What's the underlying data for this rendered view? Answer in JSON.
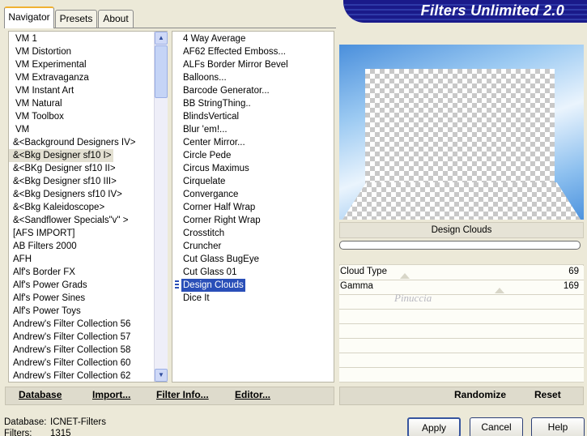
{
  "window": {
    "title": "Filters Unlimited 2.0"
  },
  "tabs": [
    {
      "label": "Navigator",
      "active": true
    },
    {
      "label": "Presets",
      "active": false
    },
    {
      "label": "About",
      "active": false
    }
  ],
  "categories": [
    "VM 1",
    "VM Distortion",
    "VM Experimental",
    "VM Extravaganza",
    "VM Instant Art",
    "VM Natural",
    "VM Toolbox",
    "VM",
    "&<Background Designers IV>",
    "&<Bkg Designer sf10 I>",
    "&<BKg Designer sf10 II>",
    "&<Bkg Designer sf10 III>",
    "&<Bkg Designers sf10 IV>",
    "&<Bkg Kaleidoscope>",
    "&<Sandflower Specials\"v\" >",
    "[AFS IMPORT]",
    "AB Filters 2000",
    "AFH",
    "Alf's Border FX",
    "Alf's Power Grads",
    "Alf's Power Sines",
    "Alf's Power Toys",
    "Andrew's Filter Collection 56",
    "Andrew's Filter Collection 57",
    "Andrew's Filter Collection 58",
    "Andrew's Filter Collection 60",
    "Andrew's Filter Collection 62"
  ],
  "selected_category": "&<Bkg Designer sf10 I>",
  "filters": [
    "4 Way Average",
    "AF62 Effected Emboss...",
    "ALFs Border Mirror Bevel",
    "Balloons...",
    "Barcode Generator...",
    "BB StringThing..",
    "BlindsVertical",
    "Blur 'em!...",
    "Center Mirror...",
    "Circle Pede",
    "Circus Maximus",
    "Cirquelate",
    "Convergance",
    "Corner Half Wrap",
    "Corner Right Wrap",
    "Crosstitch",
    "Cruncher",
    "Cut Glass  BugEye",
    "Cut Glass 01",
    "Design Clouds",
    "Dice It"
  ],
  "selected_filter": "Design Clouds",
  "preview": {
    "filter_name": "Design Clouds",
    "progress": 0
  },
  "params": [
    {
      "label": "Cloud Type",
      "value": "69",
      "level": 0.27
    },
    {
      "label": "Gamma",
      "value": "169",
      "level": 0.66
    }
  ],
  "bottom_buttons": {
    "database": "Database",
    "import": "Import...",
    "filter_info": "Filter Info...",
    "editor": "Editor...",
    "randomize": "Randomize",
    "reset": "Reset"
  },
  "footer": {
    "database_label": "Database:",
    "database_value": "ICNET-Filters",
    "filters_label": "Filters:",
    "filters_value": "1315"
  },
  "dialog_buttons": {
    "apply": "Apply",
    "cancel": "Cancel",
    "help": "Help"
  },
  "colors": {
    "banner": "#1a1a8a",
    "selection": "#2a4fb8",
    "active_tab_accent": "#f0b132"
  },
  "watermark": "Pinuccia"
}
